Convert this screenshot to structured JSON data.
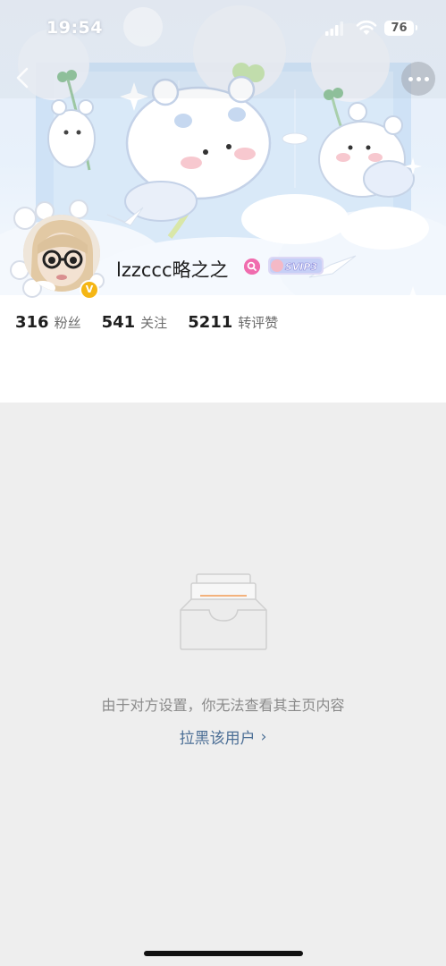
{
  "status_bar": {
    "time": "19:54",
    "battery": "76"
  },
  "profile": {
    "username": "lzzccc略之之",
    "verified_badge": "V",
    "vip_badge": "SVIP3",
    "stats": [
      {
        "value": "316",
        "label": "粉丝"
      },
      {
        "value": "541",
        "label": "关注"
      },
      {
        "value": "5211",
        "label": "转评赞"
      }
    ]
  },
  "empty_state": {
    "message": "由于对方设置，你无法查看其主页内容",
    "block_link": "拉黑该用户",
    "block_chevron": "›"
  },
  "icons": {
    "signal": "signal-icon",
    "wifi": "wifi-icon",
    "more": "more-icon",
    "back": "back-icon",
    "empty": "inbox-icon"
  },
  "colors": {
    "link": "#4c6f96",
    "verified": "#f5b614",
    "background": "#eeeeee"
  }
}
